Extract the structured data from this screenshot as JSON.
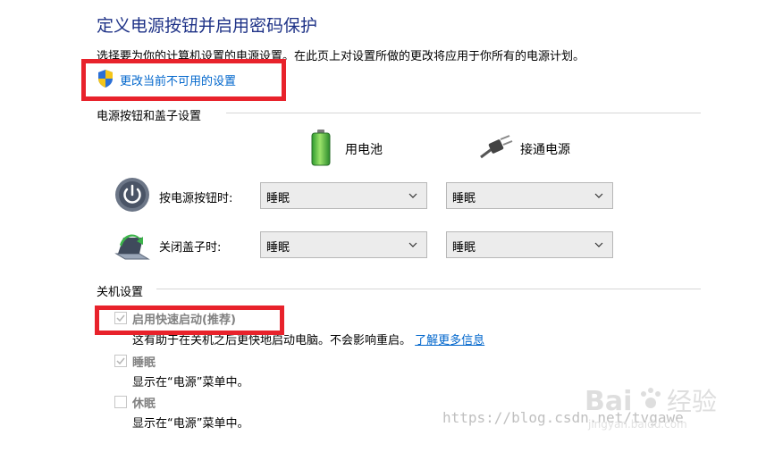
{
  "header": {
    "title": "定义电源按钮并启用密码保护",
    "description": "选择要为你的计算机设置的电源设置。在此页上对设置所做的更改将应用于你所有的电源计划。",
    "change_link": "更改当前不可用的设置"
  },
  "power_section": {
    "title": "电源按钮和盖子设置",
    "columns": [
      "用电池",
      "接通电源"
    ],
    "rows": [
      {
        "label": "按电源按钮时:",
        "on_battery": "睡眠",
        "plugged_in": "睡眠"
      },
      {
        "label": "关闭盖子时:",
        "on_battery": "睡眠",
        "plugged_in": "睡眠"
      }
    ]
  },
  "shutdown_section": {
    "title": "关机设置",
    "options": [
      {
        "label": "启用快速启动(推荐)",
        "checked": true,
        "description": "这有助于在关机之后更快地启动电脑。不会影响重启。",
        "link": "了解更多信息"
      },
      {
        "label": "睡眠",
        "checked": true,
        "description": "显示在“电源”菜单中。"
      },
      {
        "label": "休眠",
        "checked": false,
        "description": "显示在“电源”菜单中。"
      }
    ]
  },
  "watermark": {
    "url": "https://blog.csdn.net/tvgawe",
    "logo_text": "Baidu 经验",
    "logo_subtext": "jingyan.baidu.com"
  },
  "colors": {
    "title": "#1e3287",
    "link": "#0066cc",
    "highlight_box": "#e8222b"
  },
  "icons": [
    "shield-icon",
    "battery-icon",
    "plug-icon",
    "power-button-icon",
    "laptop-lid-icon",
    "chevron-down-icon",
    "checkmark-icon"
  ]
}
